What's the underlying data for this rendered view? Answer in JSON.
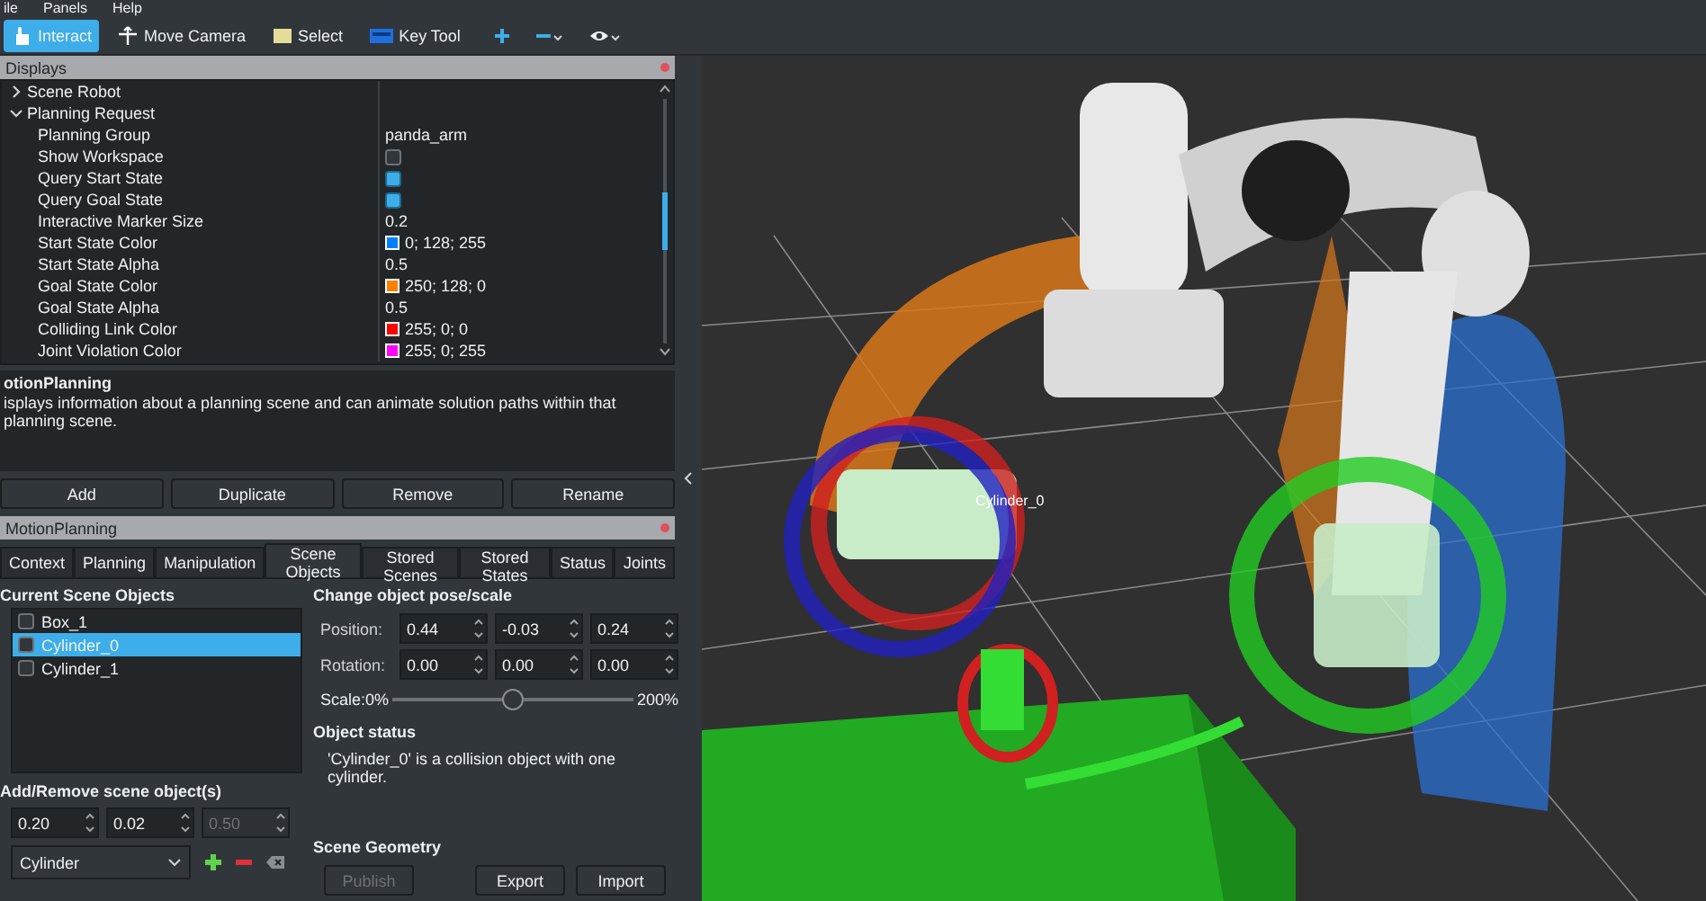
{
  "menu": [
    {
      "label": "ile"
    },
    {
      "label": "Panels"
    },
    {
      "label": "Help"
    }
  ],
  "toolbar": {
    "tools": [
      {
        "label": "Interact",
        "selected": true
      },
      {
        "label": "Move Camera",
        "selected": false
      },
      {
        "label": "Select",
        "selected": false
      },
      {
        "label": "Key Tool",
        "selected": false
      }
    ]
  },
  "displays": {
    "title": "Displays",
    "tree": [
      {
        "label": "Scene Robot",
        "expanded": false
      },
      {
        "label": "Planning Request",
        "expanded": true,
        "children": [
          {
            "label": "Planning Group",
            "kind": "text",
            "value": "panda_arm"
          },
          {
            "label": "Show Workspace",
            "kind": "checkbox",
            "checked": false
          },
          {
            "label": "Query Start State",
            "kind": "checkbox",
            "checked": true
          },
          {
            "label": "Query Goal State",
            "kind": "checkbox",
            "checked": true
          },
          {
            "label": "Interactive Marker Size",
            "kind": "text",
            "value": "0.2"
          },
          {
            "label": "Start State Color",
            "kind": "color",
            "color": "#0080ff",
            "value": "0; 128; 255"
          },
          {
            "label": "Start State Alpha",
            "kind": "text",
            "value": "0.5"
          },
          {
            "label": "Goal State Color",
            "kind": "color",
            "color": "#fa8000",
            "value": "250; 128; 0"
          },
          {
            "label": "Goal State Alpha",
            "kind": "text",
            "value": "0.5"
          },
          {
            "label": "Colliding Link Color",
            "kind": "color",
            "color": "#ff0000",
            "value": "255; 0; 0"
          },
          {
            "label": "Joint Violation Color",
            "kind": "color",
            "color": "#ff00ff",
            "value": "255; 0; 255"
          }
        ]
      }
    ]
  },
  "description": {
    "title": "otionPlanning",
    "text": "isplays information about a planning scene and can animate solution paths within that planning scene."
  },
  "display_buttons": [
    {
      "label": "Add"
    },
    {
      "label": "Duplicate"
    },
    {
      "label": "Remove"
    },
    {
      "label": "Rename"
    }
  ],
  "motion_planning": {
    "title": "MotionPlanning",
    "tabs": [
      {
        "label": "Context",
        "selected": false
      },
      {
        "label": "Planning",
        "selected": false
      },
      {
        "label": "Manipulation",
        "selected": false
      },
      {
        "label": "Scene Objects",
        "selected": true
      },
      {
        "label": "Stored Scenes",
        "selected": false
      },
      {
        "label": "Stored States",
        "selected": false
      },
      {
        "label": "Status",
        "selected": false
      },
      {
        "label": "Joints",
        "selected": false
      }
    ],
    "scene_objects": {
      "heading": "Current Scene Objects",
      "items": [
        {
          "label": "Box_1",
          "checked": false,
          "selected": false
        },
        {
          "label": "Cylinder_0",
          "checked": false,
          "selected": true
        },
        {
          "label": "Cylinder_1",
          "checked": false,
          "selected": false
        }
      ]
    },
    "add_remove": {
      "heading": "Add/Remove scene object(s)",
      "fields": [
        {
          "value": "0.20",
          "disabled": false
        },
        {
          "value": "0.02",
          "disabled": false
        },
        {
          "value": "0.50",
          "disabled": true
        }
      ],
      "shape": "Cylinder"
    },
    "pose": {
      "heading": "Change object pose/scale",
      "rows": [
        {
          "label": "Position:",
          "values": [
            "0.44",
            "-0.03",
            "0.24"
          ]
        },
        {
          "label": "Rotation:",
          "values": [
            "0.00",
            "0.00",
            "0.00"
          ]
        }
      ],
      "scale": {
        "min_label": "Scale:0%",
        "max_label": "200%",
        "level": 0.5
      }
    },
    "status": {
      "heading": "Object status",
      "text": "'Cylinder_0' is a collision object with one cylinder."
    },
    "geometry": {
      "heading": "Scene Geometry",
      "buttons": [
        {
          "label": "Publish",
          "disabled": true
        },
        {
          "label": "Export",
          "disabled": false
        },
        {
          "label": "Import",
          "disabled": false
        }
      ]
    }
  },
  "viewport": {
    "object_label": "Cylinder_0"
  }
}
